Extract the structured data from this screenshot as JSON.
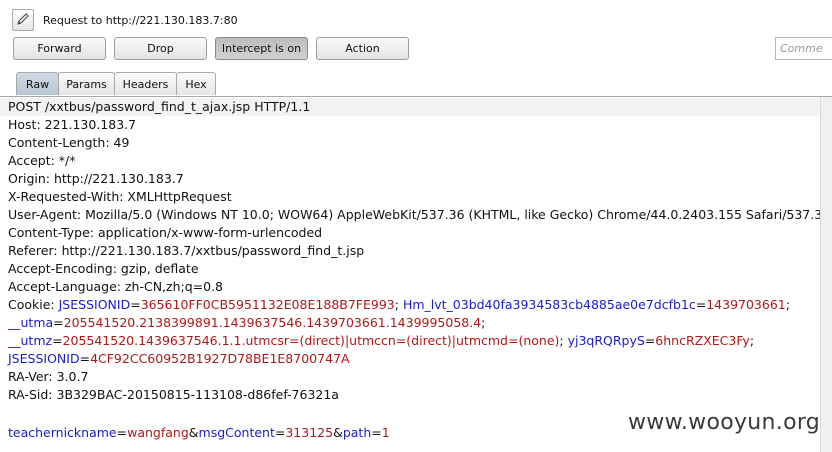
{
  "header": {
    "title": "Request to http://221.130.183.7:80",
    "forward_label": "Forward",
    "drop_label": "Drop",
    "intercept_label": "Intercept is on",
    "action_label": "Action",
    "comment_placeholder": "Comme"
  },
  "tabs": [
    {
      "label": "Raw",
      "active": true
    },
    {
      "label": "Params",
      "active": false
    },
    {
      "label": "Headers",
      "active": false
    },
    {
      "label": "Hex",
      "active": false
    }
  ],
  "request": {
    "request_line": "POST /xxtbus/password_find_t_ajax.jsp HTTP/1.1",
    "headers": [
      "Host: 221.130.183.7",
      "Content-Length: 49",
      "Accept: */*",
      "Origin: http://221.130.183.7",
      "X-Requested-With: XMLHttpRequest",
      "User-Agent: Mozilla/5.0 (Windows NT 10.0; WOW64) AppleWebKit/537.36 (KHTML, like Gecko) Chrome/44.0.2403.155 Safari/537.3",
      "Content-Type: application/x-www-form-urlencoded",
      "Referer: http://221.130.183.7/xxtbus/password_find_t.jsp",
      "Accept-Encoding: gzip, deflate",
      "Accept-Language: zh-CN,zh;q=0.8"
    ],
    "cookie_label": "Cookie: ",
    "cookie_lines": [
      [
        {
          "t": "JSESSIONID",
          "c": "k"
        },
        {
          "t": "=",
          "c": "p"
        },
        {
          "t": "365610FF0CB5951132E08E188B7FE993",
          "c": "v"
        },
        {
          "t": "; ",
          "c": "p"
        },
        {
          "t": "Hm_lvt_03bd40fa3934583cb4885ae0e7dcfb1c",
          "c": "k"
        },
        {
          "t": "=",
          "c": "p"
        },
        {
          "t": "1439703661",
          "c": "v"
        },
        {
          "t": ";",
          "c": "p"
        }
      ],
      [
        {
          "t": "__utma",
          "c": "k"
        },
        {
          "t": "=",
          "c": "p"
        },
        {
          "t": "205541520.2138399891.1439637546.1439703661.1439995058.4",
          "c": "v"
        },
        {
          "t": ";",
          "c": "p"
        }
      ],
      [
        {
          "t": "__utmz",
          "c": "k"
        },
        {
          "t": "=",
          "c": "p"
        },
        {
          "t": "205541520.1439637546.1.1.utmcsr=(direct)|utmccn=(direct)|utmcmd=(none)",
          "c": "v"
        },
        {
          "t": "; ",
          "c": "p"
        },
        {
          "t": "yj3qRQRpyS",
          "c": "k"
        },
        {
          "t": "=",
          "c": "p"
        },
        {
          "t": "6hncRZXEC3Fy",
          "c": "v"
        },
        {
          "t": ";",
          "c": "p"
        }
      ],
      [
        {
          "t": "JSESSIONID",
          "c": "k"
        },
        {
          "t": "=",
          "c": "p"
        },
        {
          "t": "4CF92CC60952B1927D78BE1E8700747A",
          "c": "v"
        }
      ]
    ],
    "trailing_headers": [
      "RA-Ver: 3.0.7",
      "RA-Sid: 3B329BAC-20150815-113108-d86fef-76321a"
    ],
    "body": [
      {
        "t": "teachernickname",
        "c": "k"
      },
      {
        "t": "=",
        "c": "p"
      },
      {
        "t": "wangfang",
        "c": "v"
      },
      {
        "t": "&",
        "c": "p"
      },
      {
        "t": "msgContent",
        "c": "k"
      },
      {
        "t": "=",
        "c": "p"
      },
      {
        "t": "313125",
        "c": "v"
      },
      {
        "t": "&",
        "c": "p"
      },
      {
        "t": "path",
        "c": "k"
      },
      {
        "t": "=",
        "c": "p"
      },
      {
        "t": "1",
        "c": "v"
      }
    ]
  },
  "watermark": "www.wooyun.org",
  "colors": {
    "param_name": "#1c1cc8",
    "param_value": "#b01818"
  }
}
